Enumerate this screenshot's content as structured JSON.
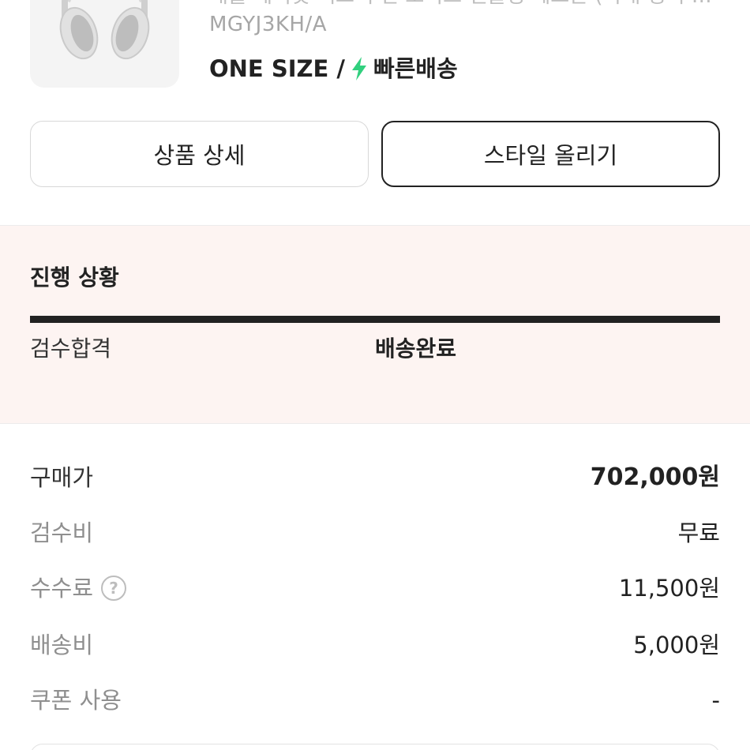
{
  "product": {
    "name": "애플 에어팟 맥스 무선 노이즈 캔슬링 헤드폰 (국내 정식 발매 제품)",
    "model": "MGYJ3KH/A",
    "size": "ONE SIZE",
    "separator": "/",
    "delivery": "빠른배송",
    "delivery_icon": "lightning-bolt-icon",
    "delivery_color": "#31d07e",
    "image": "airpods-max-silver"
  },
  "actions": {
    "detail_label": "상품 상세",
    "style_label": "스타일 올리기"
  },
  "progress": {
    "title": "진행 상황",
    "steps": [
      "검수합격",
      "배송완료"
    ],
    "current_step": "배송완료",
    "completion": 1.0
  },
  "price": {
    "purchase": {
      "label": "구매가",
      "value": "702,000원"
    },
    "inspection": {
      "label": "검수비",
      "value": "무료"
    },
    "fee": {
      "label": "수수료",
      "value": "11,500원",
      "icon": "question-circle-icon"
    },
    "shipping": {
      "label": "배송비",
      "value": "5,000원"
    },
    "coupon": {
      "label": "쿠폰 사용",
      "value": "-"
    }
  },
  "colors": {
    "progress_bg": "#fdf4f2",
    "accent": "#222222"
  }
}
